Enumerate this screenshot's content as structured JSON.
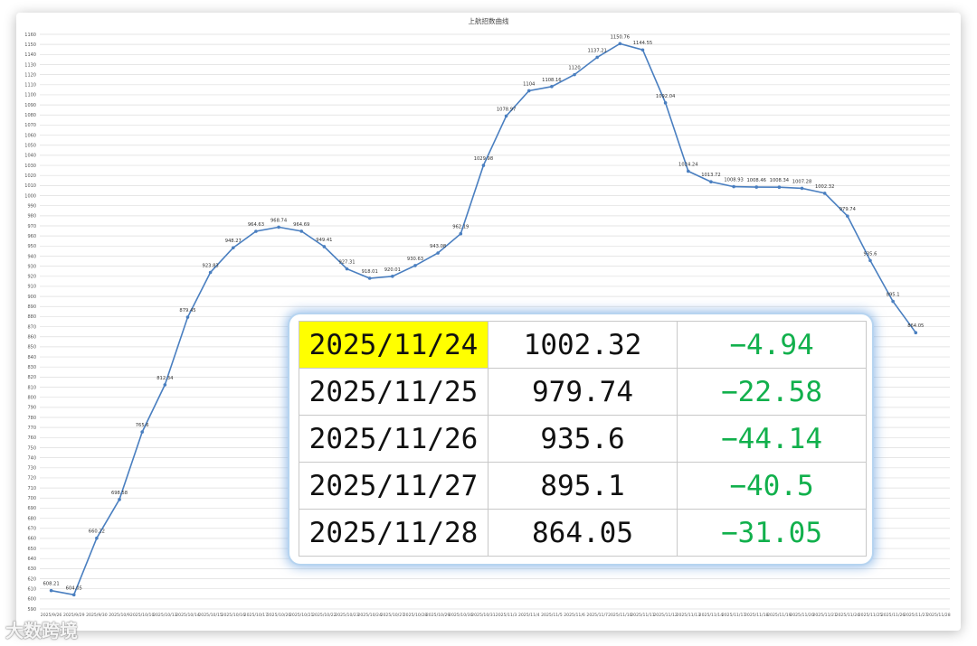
{
  "chart_data": {
    "type": "line",
    "title": "上航招数曲线",
    "xlabel": "",
    "ylabel": "",
    "ylim": [
      590,
      1160
    ],
    "y_tick_step": 10,
    "grid": true,
    "legend": "none",
    "color": "#4a7fc0",
    "categories": [
      "2025/9/26",
      "2025/9/29",
      "2025/9/30",
      "2025/10/9",
      "2025/10/10",
      "2025/10/13",
      "2025/10/14",
      "2025/10/15",
      "2025/10/16",
      "2025/10/17",
      "2025/10/20",
      "2025/10/21",
      "2025/10/22",
      "2025/10/23",
      "2025/10/24",
      "2025/10/27",
      "2025/10/28",
      "2025/10/29",
      "2025/10/30",
      "2025/10/31",
      "2025/11/3",
      "2025/11/4",
      "2025/11/5",
      "2025/11/6",
      "2025/11/7",
      "2025/11/10",
      "2025/11/11",
      "2025/11/12",
      "2025/11/13",
      "2025/11/14",
      "2025/11/17",
      "2025/11/18",
      "2025/11/19",
      "2025/11/20",
      "2025/11/21",
      "2025/11/24",
      "2025/11/25",
      "2025/11/26",
      "2025/11/27",
      "2025/11/28"
    ],
    "tick_labels": [
      "2025/9/26",
      "2025/9/29",
      "2025/9/30",
      "2025/10/9",
      "2025/10/10",
      "2025/10/13",
      "2025/10/14",
      "2025/10/15",
      "2025/10/16",
      "2025/10/17",
      "2025/10/20",
      "2025/10/21",
      "2025/10/22",
      "2025/10/23",
      "2025/10/24",
      "2025/10/27",
      "2025/10/28",
      "2025/10/29",
      "2025/10/30",
      "2025/10/31",
      "2025/11/3",
      "2025/11/4",
      "2025/11/5",
      "2025/11/6",
      "2025/11/7",
      "2025/11/10",
      "2025/11/11",
      "2025/11/12",
      "2025/11/13",
      "2025/11/14",
      "2025/11/17",
      "2025/11/18",
      "2025/11/19",
      "2025/11/20",
      "2025/11/21",
      "2025/11/24",
      "2025/11/25",
      "2025/11/26",
      "2025/11/27",
      "2025/11/28"
    ],
    "values": [
      608.21,
      604.05,
      660.22,
      698.58,
      765.6,
      812.34,
      879.45,
      923.83,
      948.27,
      964.63,
      968.74,
      964.69,
      949.41,
      927.31,
      918.01,
      920.01,
      930.63,
      943.08,
      962.19,
      1029.98,
      1078.97,
      1104,
      1108.16,
      1120,
      1137.21,
      1150.76,
      1144.55,
      1092.04,
      1024.24,
      1013.72,
      1008.93,
      1008.46,
      1008.34,
      1007.28,
      1002.32,
      979.74,
      935.6,
      895.1,
      864.05
    ],
    "data_labels": [
      "608.21",
      "604.05",
      "660.22",
      "698.58",
      "765.6",
      "812.34",
      "879.45",
      "923.83",
      "948.27",
      "964.63",
      "968.74",
      "964.69",
      "949.41",
      "927.31",
      "918.01",
      "920.01",
      "930.63",
      "943.08",
      "962.19",
      "1029.98",
      "1078.97",
      "1104",
      "1108.16",
      "1120",
      "1137.21",
      "1150.76",
      "1144.55",
      "1092.04",
      "1024.24",
      "1013.72",
      "1008.93",
      "1008.46",
      "1008.34",
      "1007.28",
      "1002.32",
      "979.74",
      "935.6",
      "895.1",
      "864.05"
    ]
  },
  "table": {
    "rows": [
      {
        "date": "2025/11/24",
        "value": "1002.32",
        "change": "−4.94",
        "highlight": true
      },
      {
        "date": "2025/11/25",
        "value": "979.74",
        "change": "−22.58",
        "highlight": false
      },
      {
        "date": "2025/11/26",
        "value": "935.6",
        "change": "−44.14",
        "highlight": false
      },
      {
        "date": "2025/11/27",
        "value": "895.1",
        "change": "−40.5",
        "highlight": false
      },
      {
        "date": "2025/11/28",
        "value": "864.05",
        "change": "−31.05",
        "highlight": false
      }
    ],
    "highlight_color": "#ffff00",
    "change_color": "#11b04c"
  },
  "watermark": "大数跨境"
}
